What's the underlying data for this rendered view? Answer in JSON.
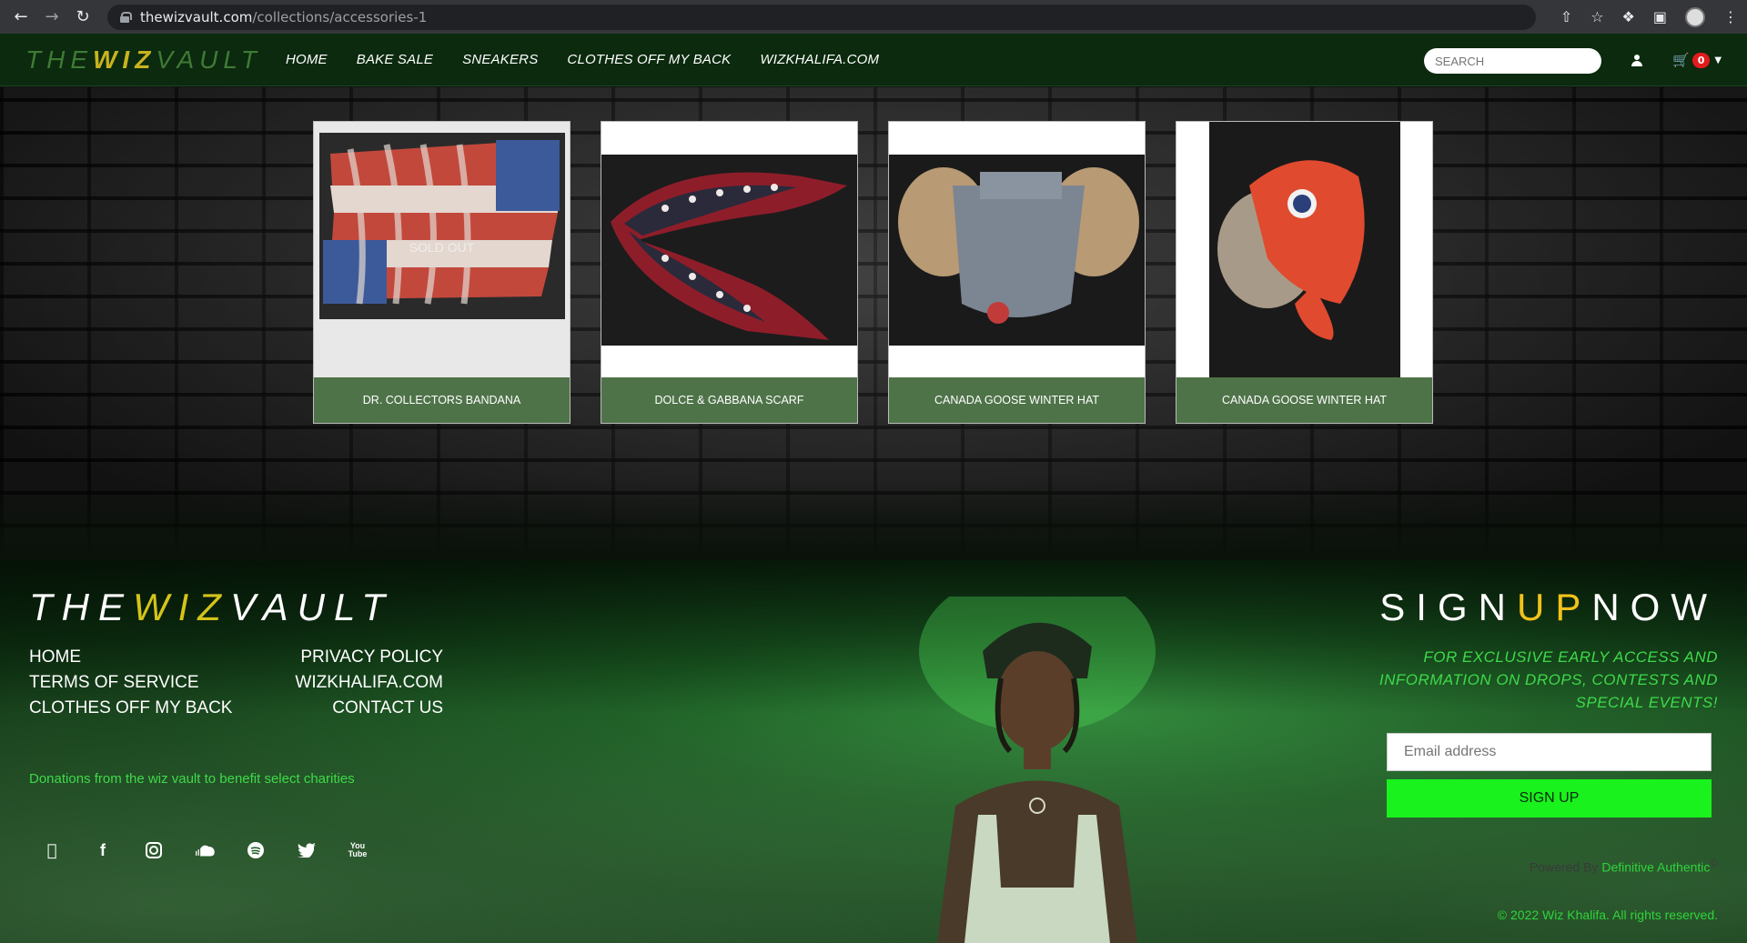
{
  "browser": {
    "url_host": "thewizvault.com",
    "url_path": "/collections/accessories-1"
  },
  "nav": {
    "logo_pre": "THE",
    "logo_wiz": "WIZ",
    "logo_post": "VAULT",
    "items": [
      "HOME",
      "BAKE SALE",
      "SNEAKERS",
      "CLOTHES OFF MY BACK",
      "WIZKHALIFA.COM"
    ],
    "search_placeholder": "SEARCH",
    "cart_count": "0"
  },
  "products": [
    {
      "name": "DR. COLLECTORS BANDANA",
      "overlay": "SOLD OUT"
    },
    {
      "name": "DOLCE & GABBANA SCARF"
    },
    {
      "name": "CANADA GOOSE WINTER HAT"
    },
    {
      "name": "CANADA GOOSE WINTER HAT"
    }
  ],
  "footer": {
    "logo_pre": "THE",
    "logo_wiz": "WIZ",
    "logo_post": "VAULT",
    "links_left": [
      "HOME",
      "TERMS OF SERVICE",
      "CLOTHES OFF MY BACK"
    ],
    "links_right": [
      "PRIVACY POLICY",
      "WIZKHALIFA.COM",
      "CONTACT US"
    ],
    "donations": "Donations from the wiz vault to benefit select charities",
    "socials": [
      "apple-icon",
      "facebook-icon",
      "instagram-icon",
      "soundcloud-icon",
      "spotify-icon",
      "twitter-icon",
      "youtube-icon"
    ],
    "signup_pre": "SIGN",
    "signup_up": "UP",
    "signup_post": "NOW",
    "signup_text": "FOR EXCLUSIVE EARLY ACCESS AND INFORMATION ON DROPS, CONTESTS AND SPECIAL EVENTS!",
    "email_placeholder": "Email address",
    "signup_button": "SIGN UP",
    "powered_by": "Powered By",
    "powered_brand": "Definitive Authentic",
    "powered_mark": "©",
    "copyright": "© 2022 Wiz Khalifa. All rights reserved."
  },
  "colors": {
    "nav_bg": "#0b2a0e",
    "caption_green": "#4f7349",
    "accent_yellow": "#d4c31a",
    "signup_green": "#19f21d",
    "text_green": "#3fd94a",
    "cart_badge": "#e31b1b"
  }
}
